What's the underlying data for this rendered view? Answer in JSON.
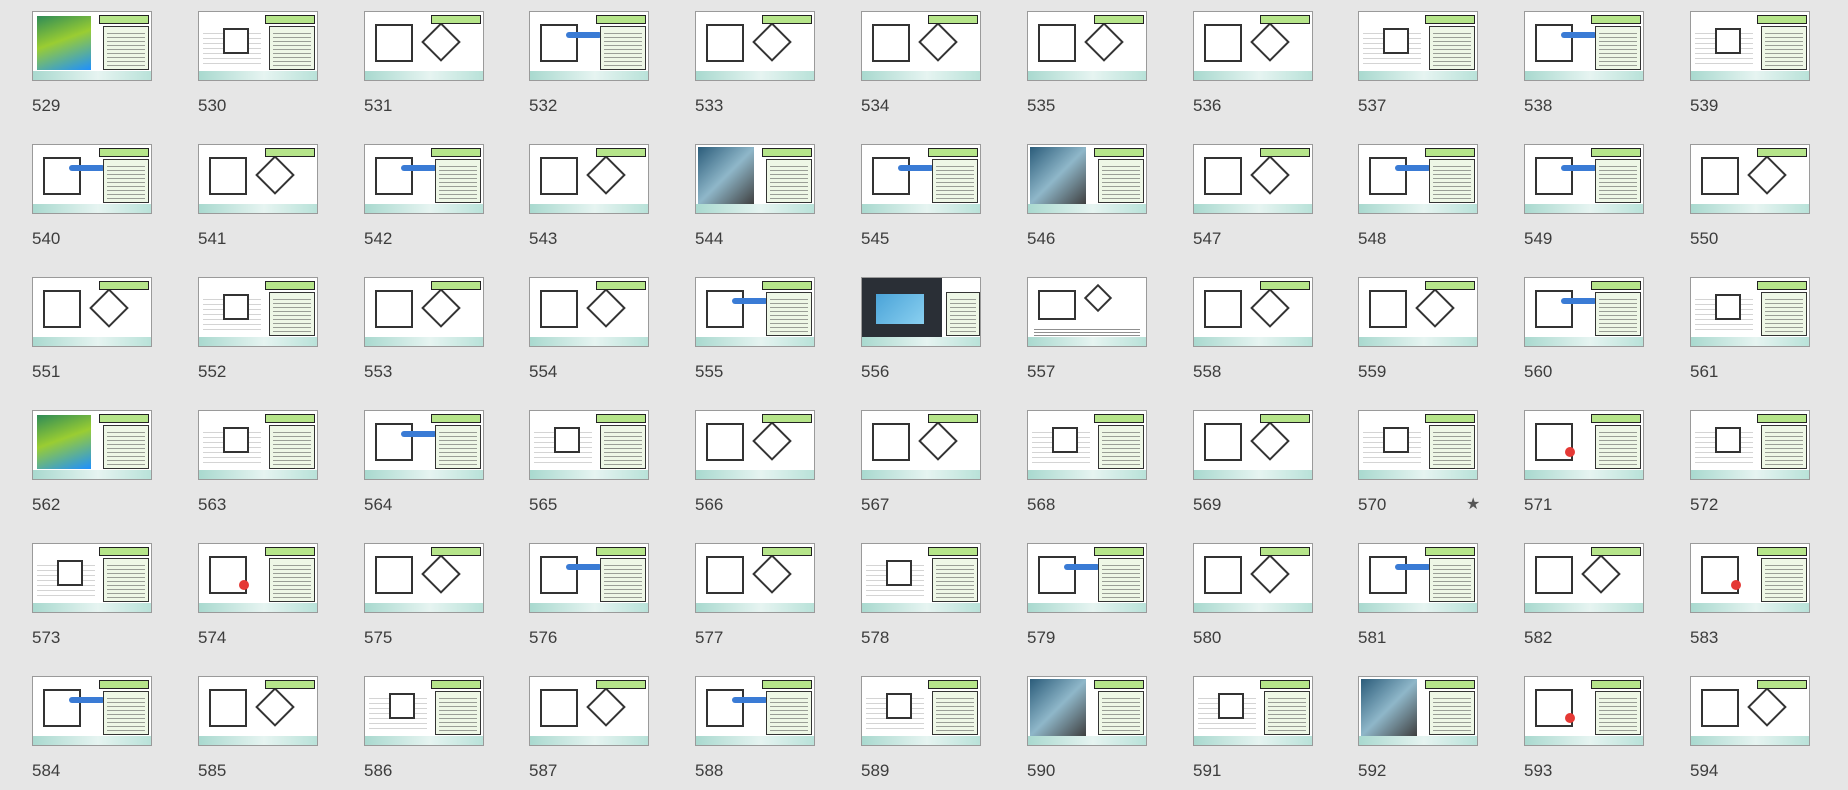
{
  "slide_sorter": {
    "slides": [
      {
        "number": "529",
        "variant": "green"
      },
      {
        "number": "530",
        "variant": "lines"
      },
      {
        "number": "531",
        "variant": "boxes"
      },
      {
        "number": "532",
        "variant": "blue"
      },
      {
        "number": "533",
        "variant": "boxes"
      },
      {
        "number": "534",
        "variant": "boxes"
      },
      {
        "number": "535",
        "variant": "boxes"
      },
      {
        "number": "536",
        "variant": "boxes"
      },
      {
        "number": "537",
        "variant": "lines"
      },
      {
        "number": "538",
        "variant": "blue"
      },
      {
        "number": "539",
        "variant": "lines"
      },
      {
        "number": "540",
        "variant": "blue"
      },
      {
        "number": "541",
        "variant": "boxes"
      },
      {
        "number": "542",
        "variant": "blue"
      },
      {
        "number": "543",
        "variant": "boxes"
      },
      {
        "number": "544",
        "variant": "photo"
      },
      {
        "number": "545",
        "variant": "blue"
      },
      {
        "number": "546",
        "variant": "photo"
      },
      {
        "number": "547",
        "variant": "boxes"
      },
      {
        "number": "548",
        "variant": "blue"
      },
      {
        "number": "549",
        "variant": "blue"
      },
      {
        "number": "550",
        "variant": "boxes"
      },
      {
        "number": "551",
        "variant": "boxes"
      },
      {
        "number": "552",
        "variant": "lines"
      },
      {
        "number": "553",
        "variant": "boxes"
      },
      {
        "number": "554",
        "variant": "boxes"
      },
      {
        "number": "555",
        "variant": "blue"
      },
      {
        "number": "556",
        "variant": "dark"
      },
      {
        "number": "557",
        "variant": "caption"
      },
      {
        "number": "558",
        "variant": "boxes"
      },
      {
        "number": "559",
        "variant": "boxes"
      },
      {
        "number": "560",
        "variant": "blue"
      },
      {
        "number": "561",
        "variant": "lines"
      },
      {
        "number": "562",
        "variant": "green"
      },
      {
        "number": "563",
        "variant": "lines"
      },
      {
        "number": "564",
        "variant": "blue"
      },
      {
        "number": "565",
        "variant": "lines"
      },
      {
        "number": "566",
        "variant": "boxes"
      },
      {
        "number": "567",
        "variant": "boxes"
      },
      {
        "number": "568",
        "variant": "lines"
      },
      {
        "number": "569",
        "variant": "boxes"
      },
      {
        "number": "570",
        "variant": "lines"
      },
      {
        "number": "571",
        "variant": "red"
      },
      {
        "number": "572",
        "variant": "lines"
      },
      {
        "number": "573",
        "variant": "lines"
      },
      {
        "number": "574",
        "variant": "red"
      },
      {
        "number": "575",
        "variant": "boxes"
      },
      {
        "number": "576",
        "variant": "blue"
      },
      {
        "number": "577",
        "variant": "boxes"
      },
      {
        "number": "578",
        "variant": "lines"
      },
      {
        "number": "579",
        "variant": "blue"
      },
      {
        "number": "580",
        "variant": "boxes"
      },
      {
        "number": "581",
        "variant": "blue"
      },
      {
        "number": "582",
        "variant": "boxes"
      },
      {
        "number": "583",
        "variant": "red"
      },
      {
        "number": "584",
        "variant": "blue"
      },
      {
        "number": "585",
        "variant": "boxes"
      },
      {
        "number": "586",
        "variant": "lines"
      },
      {
        "number": "587",
        "variant": "boxes"
      },
      {
        "number": "588",
        "variant": "blue"
      },
      {
        "number": "589",
        "variant": "lines"
      },
      {
        "number": "590",
        "variant": "photo"
      },
      {
        "number": "591",
        "variant": "lines"
      },
      {
        "number": "592",
        "variant": "photo"
      },
      {
        "number": "593",
        "variant": "red"
      },
      {
        "number": "594",
        "variant": "boxes"
      }
    ],
    "starred_slide": "570",
    "star_icon": "star-icon",
    "star_glyph": "★"
  }
}
